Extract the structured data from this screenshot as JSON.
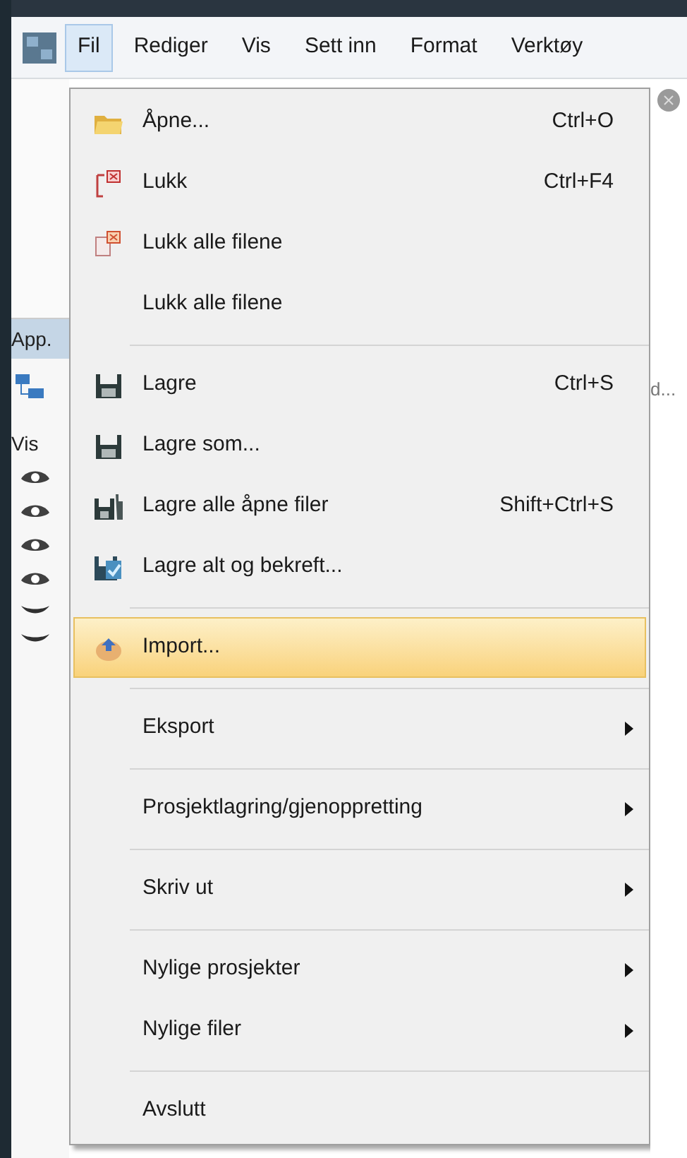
{
  "menu_bar": [
    {
      "label": "Fil",
      "selected": true
    },
    {
      "label": "Rediger",
      "selected": false
    },
    {
      "label": "Vis",
      "selected": false
    },
    {
      "label": "Sett inn",
      "selected": false
    },
    {
      "label": "Format",
      "selected": false
    },
    {
      "label": "Verktøy",
      "selected": false
    }
  ],
  "background": {
    "panel_title": "App.",
    "tree_label": "d...",
    "view_label": "Vis"
  },
  "file_menu": [
    {
      "kind": "item",
      "label": "Åpne...",
      "shortcut": "Ctrl+O",
      "submenu": false,
      "selected": false
    },
    {
      "kind": "item",
      "label": "Lukk",
      "shortcut": "Ctrl+F4",
      "submenu": false,
      "selected": false
    },
    {
      "kind": "item",
      "label": "Lukk alle filene",
      "submenu": false,
      "selected": false
    },
    {
      "kind": "item",
      "label": "Lukk alle filene",
      "submenu": false,
      "selected": false
    },
    {
      "kind": "separator"
    },
    {
      "kind": "item",
      "label": "Lagre",
      "shortcut": "Ctrl+S",
      "submenu": false,
      "selected": false
    },
    {
      "kind": "item",
      "label": "Lagre som...",
      "submenu": false,
      "selected": false
    },
    {
      "kind": "item",
      "label": "Lagre alle åpne filer",
      "shortcut": "Shift+Ctrl+S",
      "submenu": false,
      "selected": false
    },
    {
      "kind": "item",
      "label": "Lagre alt og bekreft...",
      "submenu": false,
      "selected": false
    },
    {
      "kind": "separator"
    },
    {
      "kind": "item",
      "label": "Import...",
      "submenu": false,
      "selected": true
    },
    {
      "kind": "separator"
    },
    {
      "kind": "item",
      "label": "Eksport",
      "submenu": true,
      "selected": false
    },
    {
      "kind": "separator"
    },
    {
      "kind": "item",
      "label": "Prosjektlagring/gjenoppretting",
      "submenu": true,
      "selected": false
    },
    {
      "kind": "separator"
    },
    {
      "kind": "item",
      "label": "Skriv ut",
      "submenu": true,
      "selected": false
    },
    {
      "kind": "separator"
    },
    {
      "kind": "item",
      "label": "Nylige prosjekter",
      "submenu": true,
      "selected": false
    },
    {
      "kind": "item",
      "label": "Nylige filer",
      "submenu": true,
      "selected": false
    },
    {
      "kind": "separator"
    },
    {
      "kind": "item",
      "label": "Avslutt",
      "submenu": false,
      "selected": false
    }
  ]
}
